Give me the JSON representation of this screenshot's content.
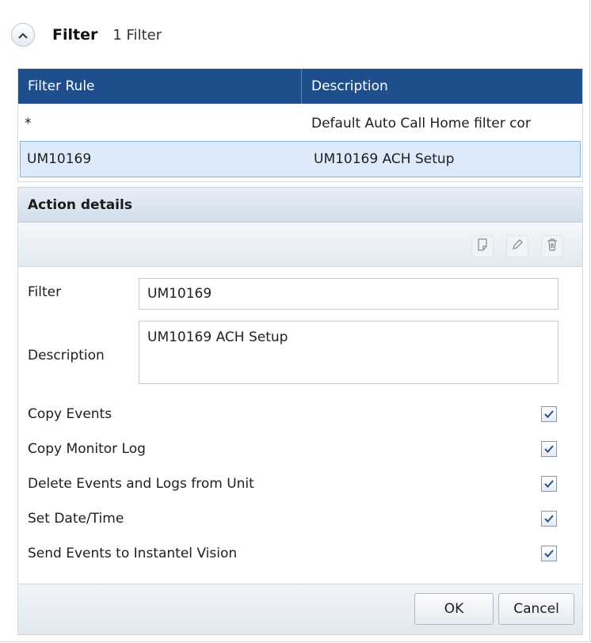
{
  "header": {
    "title": "Filter",
    "count": "1 Filter",
    "collapse_icon": "chevron-up-icon"
  },
  "table": {
    "columns": [
      "Filter Rule",
      "Description"
    ],
    "rows": [
      {
        "rule": "*",
        "description": "Default Auto Call Home filter cor"
      },
      {
        "rule": "UM10169",
        "description": "UM10169 ACH Setup",
        "selected": true
      }
    ],
    "header_color": "#1f4e8c",
    "selected_color": "#dceaf9"
  },
  "action_details": {
    "title": "Action details",
    "toolbar_icons": [
      "new-icon",
      "edit-icon",
      "delete-icon"
    ],
    "filter_label": "Filter",
    "filter_value": "UM10169",
    "description_label": "Description",
    "description_value": "UM10169 ACH Setup",
    "options": [
      {
        "label": "Copy Events",
        "checked": true
      },
      {
        "label": "Copy Monitor Log",
        "checked": true
      },
      {
        "label": "Delete Events and Logs from Unit",
        "checked": true
      },
      {
        "label": "Set Date/Time",
        "checked": true
      },
      {
        "label": "Send Events to Instantel Vision",
        "checked": true
      }
    ],
    "ok_label": "OK",
    "cancel_label": "Cancel"
  }
}
